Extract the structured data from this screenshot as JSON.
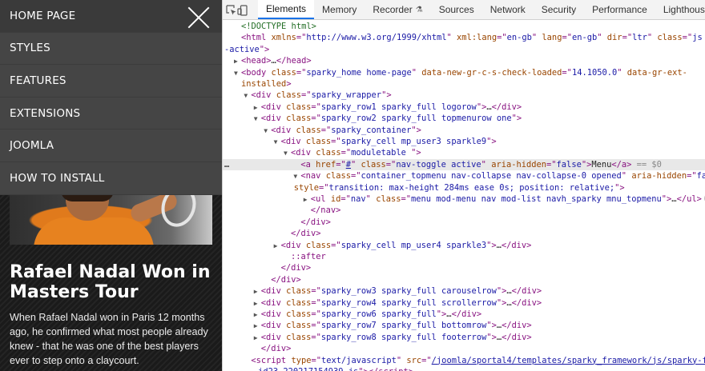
{
  "site": {
    "menu": [
      "HOME PAGE",
      "STYLES",
      "FEATURES",
      "EXTENSIONS",
      "JOOMLA",
      "HOW TO INSTALL"
    ],
    "headline": "Rafael Nadal Won in Masters Tour",
    "intro": "When Rafael Nadal won in Paris 12 months ago, he confirmed what most people already knew - that he was one of the best players ever to step onto a claycourt."
  },
  "devtools": {
    "tabs": [
      "Elements",
      "Memory",
      "Recorder",
      "Sources",
      "Network",
      "Security",
      "Performance",
      "Lighthouse"
    ],
    "active_tab": "Elements",
    "tree": [
      {
        "indent": 0,
        "arrow": "",
        "parts": [
          [
            "c",
            "<!DOCTYPE html>"
          ]
        ]
      },
      {
        "indent": 0,
        "arrow": "",
        "parts": [
          [
            "t",
            "<html"
          ],
          [
            "s",
            " "
          ],
          [
            "a",
            "xmlns"
          ],
          [
            "t",
            "=\""
          ],
          [
            "v",
            "http://www.w3.org/1999/xhtml"
          ],
          [
            "t",
            "\""
          ],
          [
            "s",
            " "
          ],
          [
            "a",
            "xml:lang"
          ],
          [
            "t",
            "=\""
          ],
          [
            "v",
            "en-gb"
          ],
          [
            "t",
            "\""
          ],
          [
            "s",
            " "
          ],
          [
            "a",
            "lang"
          ],
          [
            "t",
            "=\""
          ],
          [
            "v",
            "en-gb"
          ],
          [
            "t",
            "\""
          ],
          [
            "s",
            " "
          ],
          [
            "a",
            "dir"
          ],
          [
            "t",
            "=\""
          ],
          [
            "v",
            "ltr"
          ],
          [
            "t",
            "\""
          ],
          [
            "s",
            " "
          ],
          [
            "a",
            "class"
          ],
          [
            "t",
            "=\""
          ],
          [
            "v",
            "js js-nav"
          ]
        ]
      },
      {
        "indent": -1,
        "arrow": "",
        "parts": [
          [
            "v",
            "-active"
          ],
          [
            "t",
            "\">"
          ]
        ]
      },
      {
        "indent": 0,
        "arrow": "▶",
        "parts": [
          [
            "t",
            "<head>"
          ],
          [
            "s",
            "…"
          ],
          [
            "t",
            "</head>"
          ]
        ]
      },
      {
        "indent": 0,
        "arrow": "▼",
        "parts": [
          [
            "t",
            "<body"
          ],
          [
            "s",
            " "
          ],
          [
            "a",
            "class"
          ],
          [
            "t",
            "=\""
          ],
          [
            "v",
            "sparky_home home-page"
          ],
          [
            "t",
            "\""
          ],
          [
            "s",
            " "
          ],
          [
            "a",
            "data-new-gr-c-s-check-loaded"
          ],
          [
            "t",
            "=\""
          ],
          [
            "v",
            "14.1050.0"
          ],
          [
            "t",
            "\""
          ],
          [
            "s",
            " "
          ],
          [
            "a",
            "data-gr-ext-"
          ]
        ]
      },
      {
        "indent": 0,
        "arrow": "",
        "parts": [
          [
            "a",
            "installed"
          ],
          [
            "t",
            ">"
          ]
        ]
      },
      {
        "indent": 1,
        "arrow": "▼",
        "parts": [
          [
            "t",
            "<div"
          ],
          [
            "s",
            " "
          ],
          [
            "a",
            "class"
          ],
          [
            "t",
            "=\""
          ],
          [
            "v",
            "sparky_wrapper"
          ],
          [
            "t",
            "\">"
          ]
        ]
      },
      {
        "indent": 2,
        "arrow": "▶",
        "parts": [
          [
            "t",
            "<div"
          ],
          [
            "s",
            " "
          ],
          [
            "a",
            "class"
          ],
          [
            "t",
            "=\""
          ],
          [
            "v",
            "sparky_row1 sparky_full logorow"
          ],
          [
            "t",
            "\">"
          ],
          [
            "s",
            "…"
          ],
          [
            "t",
            "</div>"
          ]
        ]
      },
      {
        "indent": 2,
        "arrow": "▼",
        "parts": [
          [
            "t",
            "<div"
          ],
          [
            "s",
            " "
          ],
          [
            "a",
            "class"
          ],
          [
            "t",
            "=\""
          ],
          [
            "v",
            "sparky_row2 sparky_full topmenurow one"
          ],
          [
            "t",
            "\">"
          ]
        ]
      },
      {
        "indent": 3,
        "arrow": "▼",
        "parts": [
          [
            "t",
            "<div"
          ],
          [
            "s",
            " "
          ],
          [
            "a",
            "class"
          ],
          [
            "t",
            "=\""
          ],
          [
            "v",
            "sparky_container"
          ],
          [
            "t",
            "\">"
          ]
        ]
      },
      {
        "indent": 4,
        "arrow": "▼",
        "parts": [
          [
            "t",
            "<div"
          ],
          [
            "s",
            " "
          ],
          [
            "a",
            "class"
          ],
          [
            "t",
            "=\""
          ],
          [
            "v",
            "sparky_cell mp_user3 sparkle9"
          ],
          [
            "t",
            "\">"
          ]
        ]
      },
      {
        "indent": 5,
        "arrow": "▼",
        "parts": [
          [
            "t",
            "<div"
          ],
          [
            "s",
            " "
          ],
          [
            "a",
            "class"
          ],
          [
            "t",
            "=\""
          ],
          [
            "v",
            "moduletable "
          ],
          [
            "t",
            "\">"
          ]
        ]
      },
      {
        "indent": 6,
        "arrow": "",
        "selected": true,
        "parts": [
          [
            "t",
            "<a"
          ],
          [
            "s",
            " "
          ],
          [
            "a",
            "href"
          ],
          [
            "t",
            "=\""
          ],
          [
            "l",
            "#"
          ],
          [
            "t",
            "\""
          ],
          [
            "s",
            " "
          ],
          [
            "a",
            "class"
          ],
          [
            "t",
            "=\""
          ],
          [
            "v",
            "nav-toggle active"
          ],
          [
            "t",
            "\""
          ],
          [
            "s",
            " "
          ],
          [
            "a",
            "aria-hidden"
          ],
          [
            "t",
            "=\""
          ],
          [
            "v",
            "false"
          ],
          [
            "t",
            "\">"
          ],
          [
            "s",
            "Menu"
          ],
          [
            "t",
            "</a>"
          ],
          [
            "d",
            " == $0"
          ]
        ]
      },
      {
        "indent": 6,
        "arrow": "▼",
        "parts": [
          [
            "t",
            "<nav"
          ],
          [
            "s",
            " "
          ],
          [
            "a",
            "class"
          ],
          [
            "t",
            "=\""
          ],
          [
            "v",
            "container_topmenu nav-collapse nav-collapse-0 opened"
          ],
          [
            "t",
            "\""
          ],
          [
            "s",
            " "
          ],
          [
            "a",
            "aria-hidden"
          ],
          [
            "t",
            "=\""
          ],
          [
            "v",
            "false"
          ],
          [
            "t",
            "\""
          ]
        ]
      },
      {
        "indent": 5.3,
        "arrow": "",
        "parts": [
          [
            "a",
            "style"
          ],
          [
            "t",
            "=\""
          ],
          [
            "v",
            "transition: max-height 284ms ease 0s; position: relative;"
          ],
          [
            "t",
            "\">"
          ]
        ]
      },
      {
        "indent": 7,
        "arrow": "▶",
        "parts": [
          [
            "t",
            "<ul"
          ],
          [
            "s",
            " "
          ],
          [
            "a",
            "id"
          ],
          [
            "t",
            "=\""
          ],
          [
            "v",
            "nav"
          ],
          [
            "t",
            "\""
          ],
          [
            "s",
            " "
          ],
          [
            "a",
            "class"
          ],
          [
            "t",
            "=\""
          ],
          [
            "v",
            "menu mod-menu nav mod-list navh_sparky mnu_topmenu"
          ],
          [
            "t",
            "\">"
          ],
          [
            "s",
            "…"
          ],
          [
            "t",
            "</ul>"
          ],
          [
            "b",
            "flex"
          ]
        ]
      },
      {
        "indent": 7,
        "arrow": "",
        "parts": [
          [
            "t",
            "</nav>"
          ]
        ]
      },
      {
        "indent": 6,
        "arrow": "",
        "parts": [
          [
            "t",
            "</div>"
          ]
        ]
      },
      {
        "indent": 5,
        "arrow": "",
        "parts": [
          [
            "t",
            "</div>"
          ]
        ]
      },
      {
        "indent": 4,
        "arrow": "▶",
        "parts": [
          [
            "t",
            "<div"
          ],
          [
            "s",
            " "
          ],
          [
            "a",
            "class"
          ],
          [
            "t",
            "=\""
          ],
          [
            "v",
            "sparky_cell mp_user4 sparkle3"
          ],
          [
            "t",
            "\">"
          ],
          [
            "s",
            "…"
          ],
          [
            "t",
            "</div>"
          ]
        ]
      },
      {
        "indent": 5,
        "arrow": "",
        "parts": [
          [
            "p",
            "::after"
          ]
        ]
      },
      {
        "indent": 4,
        "arrow": "",
        "parts": [
          [
            "t",
            "</div>"
          ]
        ]
      },
      {
        "indent": 3,
        "arrow": "",
        "parts": [
          [
            "t",
            "</div>"
          ]
        ]
      },
      {
        "indent": 2,
        "arrow": "▶",
        "parts": [
          [
            "t",
            "<div"
          ],
          [
            "s",
            " "
          ],
          [
            "a",
            "class"
          ],
          [
            "t",
            "=\""
          ],
          [
            "v",
            "sparky_row3 sparky_full carouselrow"
          ],
          [
            "t",
            "\">"
          ],
          [
            "s",
            "…"
          ],
          [
            "t",
            "</div>"
          ]
        ]
      },
      {
        "indent": 2,
        "arrow": "▶",
        "parts": [
          [
            "t",
            "<div"
          ],
          [
            "s",
            " "
          ],
          [
            "a",
            "class"
          ],
          [
            "t",
            "=\""
          ],
          [
            "v",
            "sparky_row4 sparky_full scrollerrow"
          ],
          [
            "t",
            "\">"
          ],
          [
            "s",
            "…"
          ],
          [
            "t",
            "</div>"
          ]
        ]
      },
      {
        "indent": 2,
        "arrow": "▶",
        "parts": [
          [
            "t",
            "<div"
          ],
          [
            "s",
            " "
          ],
          [
            "a",
            "class"
          ],
          [
            "t",
            "=\""
          ],
          [
            "v",
            "sparky_row6 sparky_full"
          ],
          [
            "t",
            "\">"
          ],
          [
            "s",
            "…"
          ],
          [
            "t",
            "</div>"
          ]
        ]
      },
      {
        "indent": 2,
        "arrow": "▶",
        "parts": [
          [
            "t",
            "<div"
          ],
          [
            "s",
            " "
          ],
          [
            "a",
            "class"
          ],
          [
            "t",
            "=\""
          ],
          [
            "v",
            "sparky_row7 sparky_full bottomrow"
          ],
          [
            "t",
            "\">"
          ],
          [
            "s",
            "…"
          ],
          [
            "t",
            "</div>"
          ]
        ]
      },
      {
        "indent": 2,
        "arrow": "▶",
        "parts": [
          [
            "t",
            "<div"
          ],
          [
            "s",
            " "
          ],
          [
            "a",
            "class"
          ],
          [
            "t",
            "=\""
          ],
          [
            "v",
            "sparky_row8 sparky_full footerrow"
          ],
          [
            "t",
            "\">"
          ],
          [
            "s",
            "…"
          ],
          [
            "t",
            "</div>"
          ]
        ]
      },
      {
        "indent": 2,
        "arrow": "",
        "parts": [
          [
            "t",
            "</div>"
          ]
        ]
      },
      {
        "indent": 1,
        "arrow": "",
        "parts": [
          [
            "t",
            "<script"
          ],
          [
            "s",
            " "
          ],
          [
            "a",
            "type"
          ],
          [
            "t",
            "=\""
          ],
          [
            "v",
            "text/javascript"
          ],
          [
            "t",
            "\""
          ],
          [
            "s",
            " "
          ],
          [
            "a",
            "src"
          ],
          [
            "t",
            "=\""
          ],
          [
            "l",
            "/joomla/sportal4/templates/sparky_framework/js/sparky-footer"
          ]
        ]
      },
      {
        "indent": 1.2,
        "arrow": "",
        "parts": [
          [
            "l",
            "-id23-220217154939.js"
          ],
          [
            "t",
            "\"></"
          ],
          [
            "t",
            "script>"
          ]
        ]
      }
    ]
  }
}
